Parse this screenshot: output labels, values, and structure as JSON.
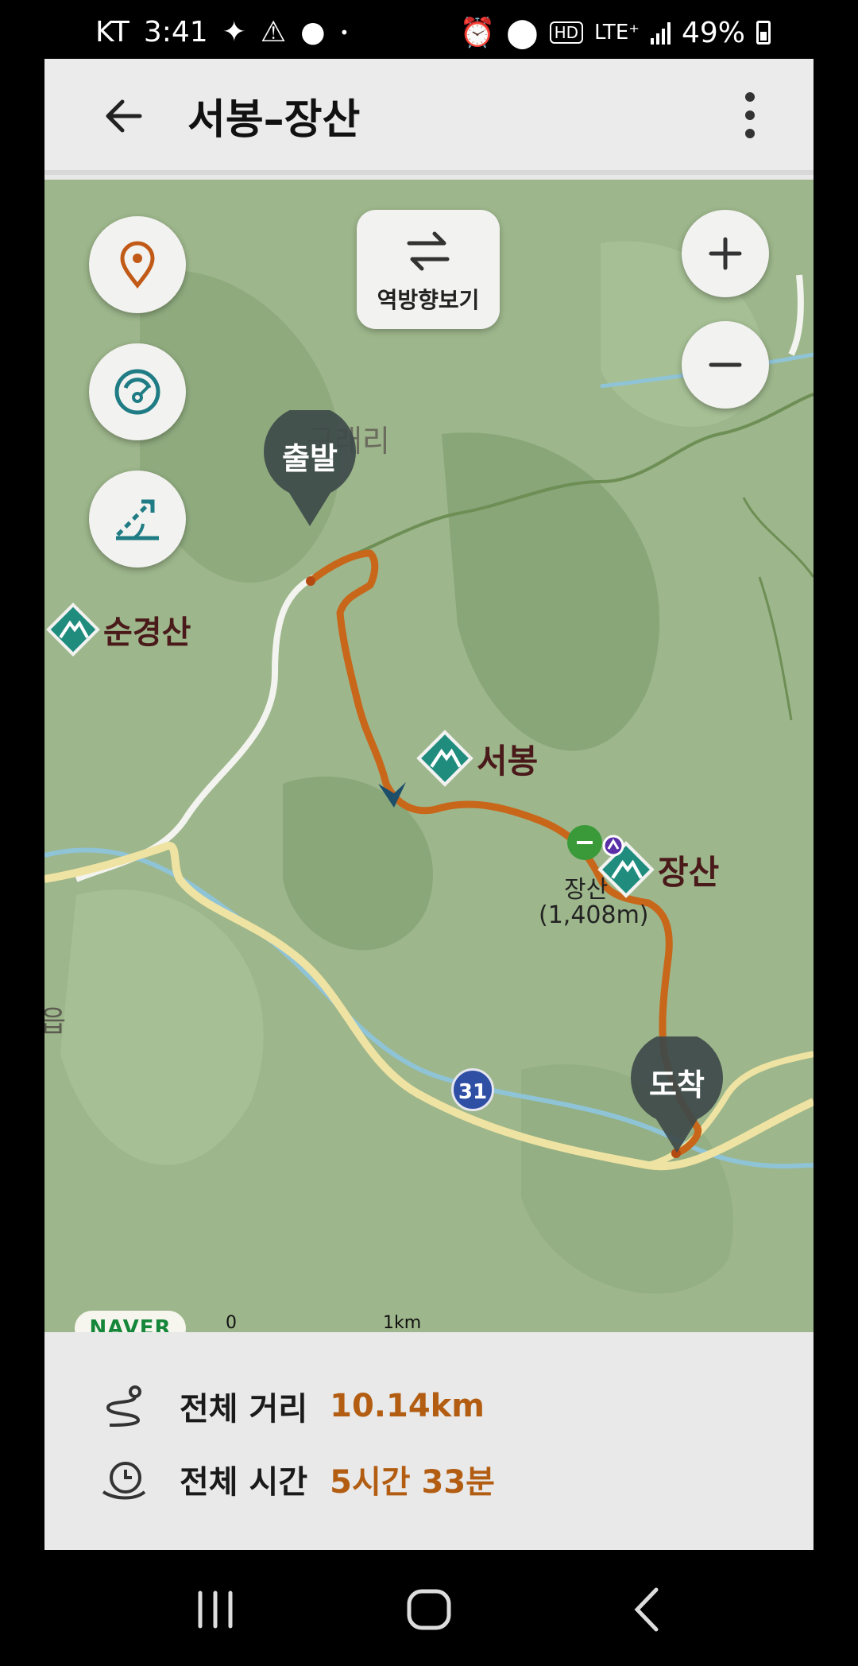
{
  "status_bar": {
    "carrier": "KT",
    "time": "3:41",
    "network": "LTE⁺",
    "battery": "49%"
  },
  "header": {
    "title": "서봉–장산"
  },
  "map": {
    "reverse_label": "역방향보기",
    "start_label": "출발",
    "end_label": "도착",
    "village_label": "구래리",
    "places": [
      {
        "name": "순경산"
      },
      {
        "name": "서봉"
      },
      {
        "name": "장산"
      }
    ],
    "summit_name": "장산",
    "summit_elevation": "(1,408m)",
    "road_number": "31",
    "edge_text": "읍",
    "provider": "NAVER",
    "scale_zero": "0",
    "scale_unit": "1km"
  },
  "summary": {
    "distance_label": "전체 거리",
    "distance_value": "10.14km",
    "time_label": "전체 시간",
    "time_value": "5시간 33분"
  },
  "colors": {
    "route": "#c8671a",
    "accent_value": "#b25d12",
    "marker_teal": "#1f8c7e",
    "map_green": "#9cb58a"
  }
}
